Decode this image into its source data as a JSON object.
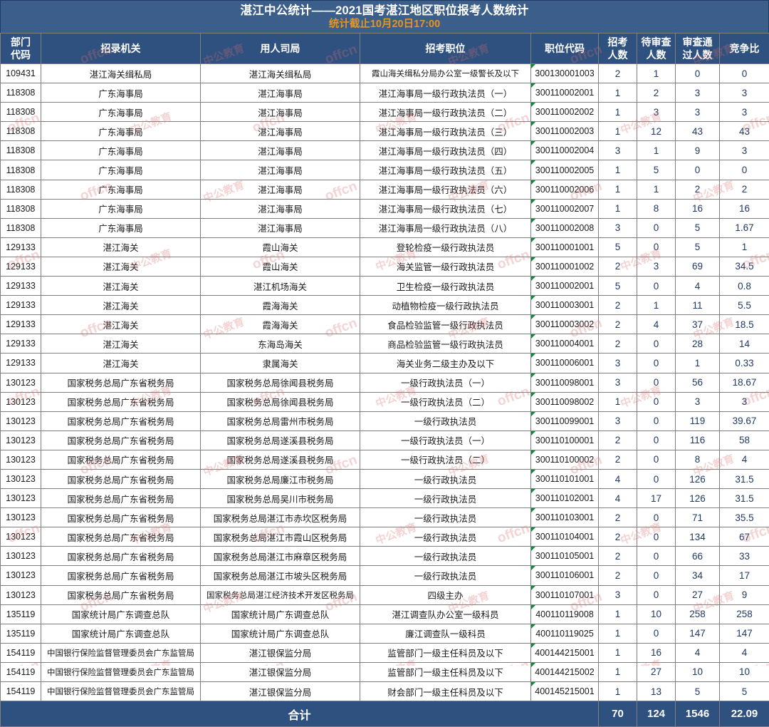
{
  "banner": {
    "title": "湛江中公统计——2021国考湛江地区职位报考人数统计",
    "subtitle": "统计截止10月20日17:00",
    "bg_color": "#3b5f8a",
    "title_color": "#ffffff",
    "subtitle_color": "#e8941f"
  },
  "table": {
    "header_bg": "#2e5180",
    "header_color": "#ffffff",
    "number_color": "#1f3864",
    "columns": [
      {
        "label_line1": "部门",
        "label_line2": "代码",
        "key": "dept_code"
      },
      {
        "label_line1": "招录机关",
        "label_line2": "",
        "key": "agency"
      },
      {
        "label_line1": "用人司局",
        "label_line2": "",
        "key": "department"
      },
      {
        "label_line1": "招考职位",
        "label_line2": "",
        "key": "position"
      },
      {
        "label_line1": "职位代码",
        "label_line2": "",
        "key": "job_code"
      },
      {
        "label_line1": "招考",
        "label_line2": "人数",
        "key": "recruit"
      },
      {
        "label_line1": "待审查",
        "label_line2": "人数",
        "key": "pending"
      },
      {
        "label_line1": "审查通",
        "label_line2": "过人数",
        "key": "passed"
      },
      {
        "label_line1": "竞争比",
        "label_line2": "",
        "key": "ratio"
      }
    ],
    "rows": [
      [
        "109431",
        "湛江海关缉私局",
        "湛江海关缉私局",
        "霞山海关缉私分局办公室一级警长及以下",
        "300130001003",
        "2",
        "1",
        "0",
        "0"
      ],
      [
        "118308",
        "广东海事局",
        "湛江海事局",
        "湛江海事局一级行政执法员（一）",
        "300110002001",
        "1",
        "2",
        "3",
        "3"
      ],
      [
        "118308",
        "广东海事局",
        "湛江海事局",
        "湛江海事局一级行政执法员（二）",
        "300110002002",
        "1",
        "3",
        "3",
        "3"
      ],
      [
        "118308",
        "广东海事局",
        "湛江海事局",
        "湛江海事局一级行政执法员（三）",
        "300110002003",
        "1",
        "12",
        "43",
        "43"
      ],
      [
        "118308",
        "广东海事局",
        "湛江海事局",
        "湛江海事局一级行政执法员（四）",
        "300110002004",
        "3",
        "1",
        "9",
        "3"
      ],
      [
        "118308",
        "广东海事局",
        "湛江海事局",
        "湛江海事局一级行政执法员（五）",
        "300110002005",
        "1",
        "5",
        "0",
        "0"
      ],
      [
        "118308",
        "广东海事局",
        "湛江海事局",
        "湛江海事局一级行政执法员（六）",
        "300110002006",
        "1",
        "1",
        "2",
        "2"
      ],
      [
        "118308",
        "广东海事局",
        "湛江海事局",
        "湛江海事局一级行政执法员（七）",
        "300110002007",
        "1",
        "8",
        "16",
        "16"
      ],
      [
        "118308",
        "广东海事局",
        "湛江海事局",
        "湛江海事局一级行政执法员（八）",
        "300110002008",
        "3",
        "0",
        "5",
        "1.67"
      ],
      [
        "129133",
        "湛江海关",
        "霞山海关",
        "登轮检疫一级行政执法员",
        "300110001001",
        "5",
        "0",
        "5",
        "1"
      ],
      [
        "129133",
        "湛江海关",
        "霞山海关",
        "海关监管一级行政执法员",
        "300110001002",
        "2",
        "3",
        "69",
        "34.5"
      ],
      [
        "129133",
        "湛江海关",
        "湛江机场海关",
        "卫生检疫一级行政执法员",
        "300110002001",
        "5",
        "0",
        "4",
        "0.8"
      ],
      [
        "129133",
        "湛江海关",
        "霞海海关",
        "动植物检疫一级行政执法员",
        "300110003001",
        "2",
        "1",
        "11",
        "5.5"
      ],
      [
        "129133",
        "湛江海关",
        "霞海海关",
        "食品检验监管一级行政执法员",
        "300110003002",
        "2",
        "4",
        "37",
        "18.5"
      ],
      [
        "129133",
        "湛江海关",
        "东海岛海关",
        "商品检验监管一级行政执法员",
        "300110004001",
        "2",
        "0",
        "28",
        "14"
      ],
      [
        "129133",
        "湛江海关",
        "隶属海关",
        "海关业务二级主办及以下",
        "300110006001",
        "3",
        "0",
        "1",
        "0.33"
      ],
      [
        "130123",
        "国家税务总局广东省税务局",
        "国家税务总局徐闻县税务局",
        "一级行政执法员（一）",
        "300110098001",
        "3",
        "0",
        "56",
        "18.67"
      ],
      [
        "130123",
        "国家税务总局广东省税务局",
        "国家税务总局徐闻县税务局",
        "一级行政执法员（二）",
        "300110098002",
        "1",
        "0",
        "3",
        "3"
      ],
      [
        "130123",
        "国家税务总局广东省税务局",
        "国家税务总局雷州市税务局",
        "一级行政执法员",
        "300110099001",
        "3",
        "0",
        "119",
        "39.67"
      ],
      [
        "130123",
        "国家税务总局广东省税务局",
        "国家税务总局遂溪县税务局",
        "一级行政执法员（一）",
        "300110100001",
        "2",
        "0",
        "116",
        "58"
      ],
      [
        "130123",
        "国家税务总局广东省税务局",
        "国家税务总局遂溪县税务局",
        "一级行政执法员（二）",
        "300110100002",
        "2",
        "0",
        "8",
        "4"
      ],
      [
        "130123",
        "国家税务总局广东省税务局",
        "国家税务总局廉江市税务局",
        "一级行政执法员",
        "300110101001",
        "4",
        "0",
        "126",
        "31.5"
      ],
      [
        "130123",
        "国家税务总局广东省税务局",
        "国家税务总局吴川市税务局",
        "一级行政执法员",
        "300110102001",
        "4",
        "17",
        "126",
        "31.5"
      ],
      [
        "130123",
        "国家税务总局广东省税务局",
        "国家税务总局湛江市赤坎区税务局",
        "一级行政执法员",
        "300110103001",
        "2",
        "0",
        "71",
        "35.5"
      ],
      [
        "130123",
        "国家税务总局广东省税务局",
        "国家税务总局湛江市霞山区税务局",
        "一级行政执法员",
        "300110104001",
        "2",
        "0",
        "134",
        "67"
      ],
      [
        "130123",
        "国家税务总局广东省税务局",
        "国家税务总局湛江市麻章区税务局",
        "一级行政执法员",
        "300110105001",
        "2",
        "0",
        "66",
        "33"
      ],
      [
        "130123",
        "国家税务总局广东省税务局",
        "国家税务总局湛江市坡头区税务局",
        "一级行政执法员",
        "300110106001",
        "2",
        "0",
        "34",
        "17"
      ],
      [
        "130123",
        "国家税务总局广东省税务局",
        "国家税务总局湛江经济技术开发区税务局",
        "四级主办",
        "300110107001",
        "3",
        "0",
        "27",
        "9"
      ],
      [
        "135119",
        "国家统计局广东调查总队",
        "国家统计局广东调查总队",
        "湛江调查队办公室一级科员",
        "400110119008",
        "1",
        "10",
        "258",
        "258"
      ],
      [
        "135119",
        "国家统计局广东调查总队",
        "国家统计局广东调查总队",
        "廉江调查队一级科员",
        "400110119025",
        "1",
        "0",
        "147",
        "147"
      ],
      [
        "154119",
        "中国银行保险监督管理委员会广东监管局",
        "湛江银保监分局",
        "监管部门一级主任科员及以下",
        "400144215001",
        "1",
        "16",
        "4",
        "4"
      ],
      [
        "154119",
        "中国银行保险监督管理委员会广东监管局",
        "湛江银保监分局",
        "监管部门一级主任科员及以下",
        "400144215002",
        "1",
        "27",
        "10",
        "10"
      ],
      [
        "154119",
        "中国银行保险监督管理委员会广东监管局",
        "湛江银保监分局",
        "财会部门一级主任科员及以下",
        "400145215001",
        "1",
        "13",
        "5",
        "5"
      ]
    ],
    "footer": {
      "label": "合计",
      "recruit": "70",
      "pending": "124",
      "passed": "1546",
      "ratio": "22.09"
    }
  },
  "watermark": {
    "text_cn": "中公教育",
    "text_en": "offcn"
  }
}
